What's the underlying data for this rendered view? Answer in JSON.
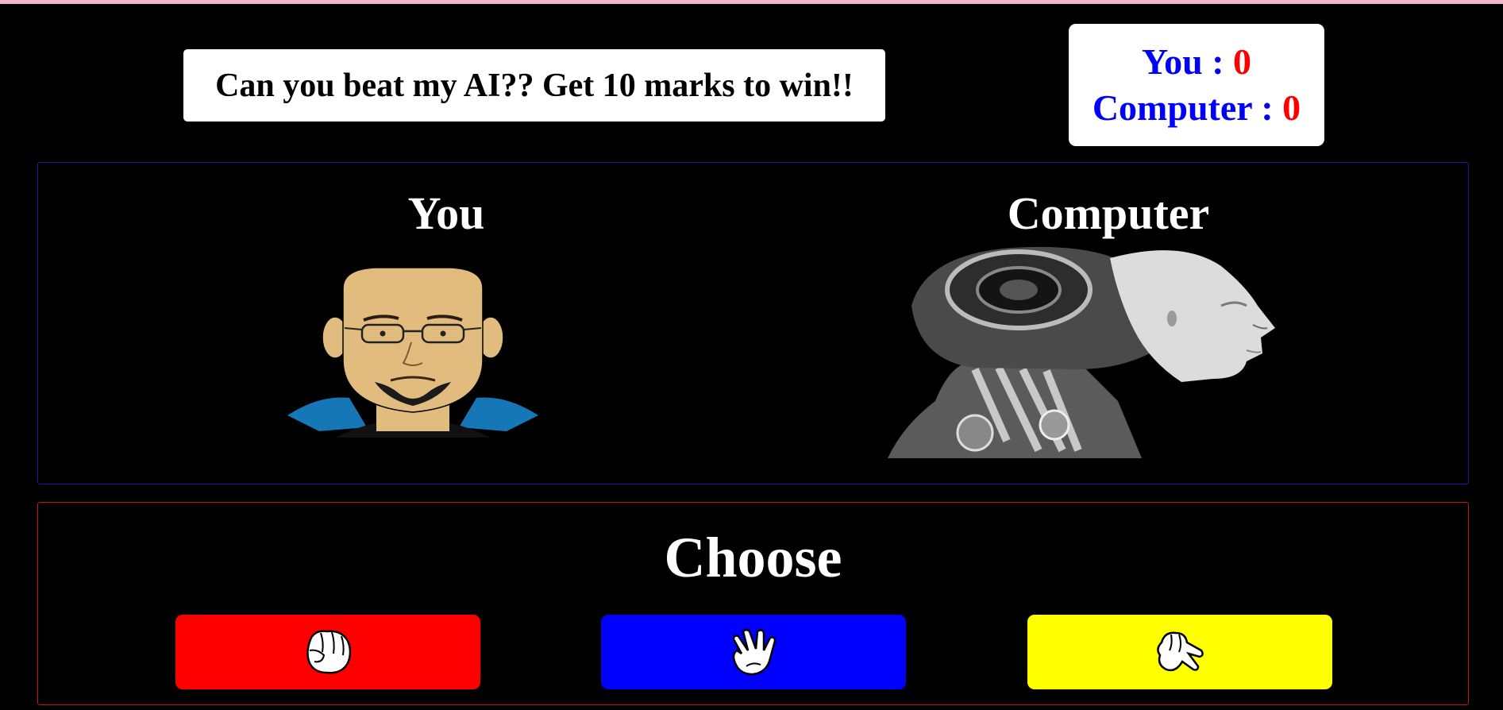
{
  "banner": {
    "text": "Can you beat my AI?? Get 10 marks to win!!"
  },
  "scoreboard": {
    "you_label": "You : ",
    "you_score": "0",
    "computer_label": "Computer : ",
    "computer_score": "0"
  },
  "arena": {
    "player": {
      "title": "You",
      "avatar": "cartoon-man-avatar"
    },
    "computer": {
      "title": "Computer",
      "avatar": "robot-head"
    }
  },
  "choose": {
    "title": "Choose",
    "options": [
      {
        "icon": "rock-fist-icon",
        "color": "#ff0000"
      },
      {
        "icon": "paper-hand-icon",
        "color": "#0000ff"
      },
      {
        "icon": "scissors-hand-icon",
        "color": "#ffff00"
      }
    ]
  },
  "colors": {
    "background": "#000000",
    "arena_border": "#1a1aa8",
    "choose_border": "#c01616",
    "score_label": "#0000ff",
    "score_value": "#ff0000"
  }
}
